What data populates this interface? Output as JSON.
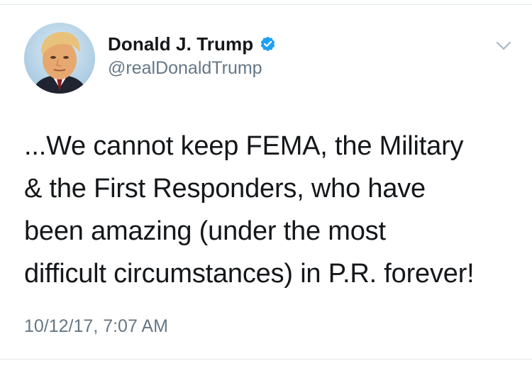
{
  "tweet": {
    "author": {
      "display_name": "Donald J. Trump",
      "handle": "@realDonaldTrump",
      "verified": true,
      "avatar_icon": "profile-photo"
    },
    "text": "...We cannot keep FEMA, the Military\n& the First Responders, who have\nbeen amazing (under the most\ndifficult circumstances) in P.R. forever!",
    "timestamp": "10/12/17, 7:07 AM",
    "menu_icon": "chevron-down-icon"
  },
  "colors": {
    "text_primary": "#14171a",
    "text_secondary": "#657786",
    "verified_blue": "#1da1f2",
    "divider": "#e1e8ed",
    "caret": "#aab8c2"
  }
}
